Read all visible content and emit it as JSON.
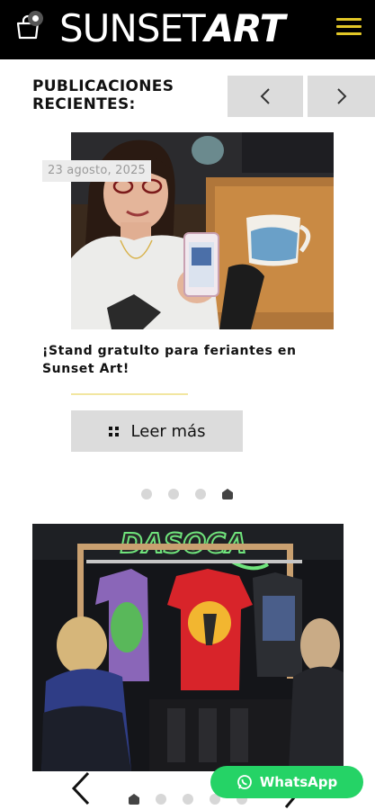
{
  "header": {
    "logo_light": "SUNSET",
    "logo_bold": "ART",
    "accent_color": "#e2c727"
  },
  "section": {
    "title": "PUBLICACIONES RECIENTES:",
    "prev_icon": "chevron-left-icon",
    "next_icon": "chevron-right-icon"
  },
  "post": {
    "date": "23 agosto, 2025",
    "title": "¡Stand gratulto para feriantes en Sunset Art!",
    "button_label": "Leer más",
    "button_icon": "grid-icon"
  },
  "carousel": {
    "dots_total": 4,
    "active_index": 3
  },
  "gallery": {
    "sign_text": "DASOCA",
    "dots_total": 5,
    "active_index": 0
  },
  "whatsapp": {
    "label": "WhatsApp",
    "color": "#25d366"
  }
}
